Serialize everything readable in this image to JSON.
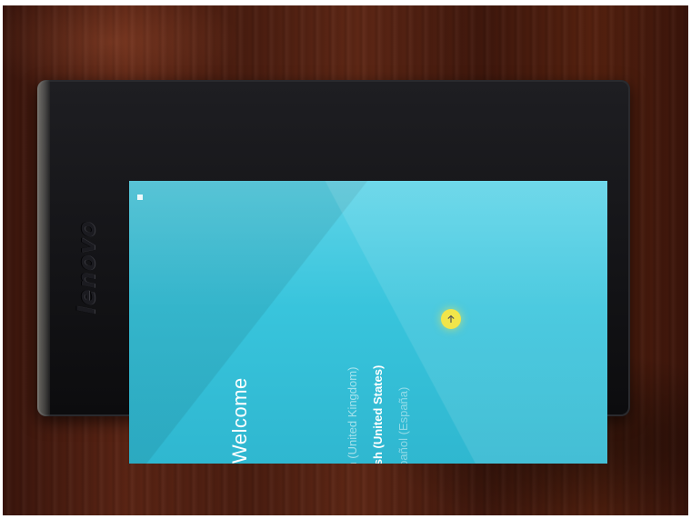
{
  "device": {
    "brand": "lenovo"
  },
  "setup": {
    "title": "Welcome",
    "languages": [
      {
        "label": "English (United Kingdom)",
        "selected": false
      },
      {
        "label": "English (United States)",
        "selected": true
      },
      {
        "label": "Español (España)",
        "selected": false
      }
    ],
    "next_icon": "arrow-right-icon"
  },
  "colors": {
    "screen_background": "#38c4dc",
    "next_button": "#f1e54a",
    "text": "#ffffff"
  }
}
